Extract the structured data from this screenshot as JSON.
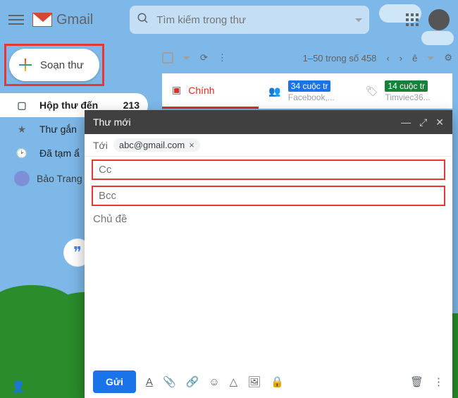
{
  "header": {
    "product": "Gmail",
    "search_placeholder": "Tìm kiếm trong thư"
  },
  "compose_button": "Soạn thư",
  "sidebar": {
    "items": [
      {
        "label": "Hộp thư đến",
        "count": "213"
      },
      {
        "label": "Thư gắn"
      },
      {
        "label": "Đã tạm ẩ"
      }
    ],
    "user": "Bảo Trang"
  },
  "toolbar": {
    "pager": "1–50 trong số 458",
    "lang": "ê"
  },
  "tabs": {
    "primary": "Chính",
    "social_badge": "34 cuộc tr",
    "social_sub": "Facebook,...",
    "promo_badge": "14 cuộc tr",
    "promo_sub": "Timviec36..."
  },
  "compose": {
    "title": "Thư mới",
    "to_label": "Tới",
    "to_chip": "abc@gmail.com",
    "cc": "Cc",
    "bcc": "Bcc",
    "subject_placeholder": "Chủ đề",
    "send": "Gửi"
  }
}
